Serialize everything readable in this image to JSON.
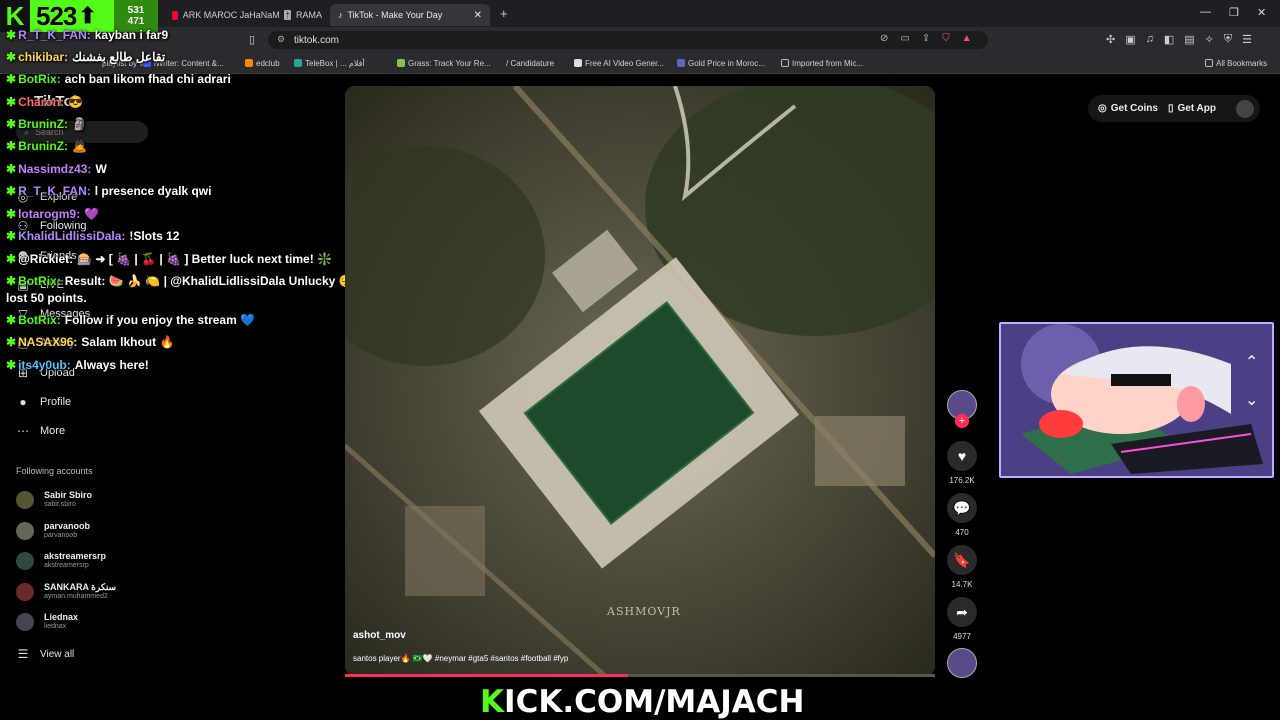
{
  "kick_badge": {
    "viewers": "523",
    "side_top": "531",
    "side_bottom": "471"
  },
  "browser": {
    "tabs": [
      {
        "label": "ARK MAROC JaHaNaM 🎚️ RAMA"
      },
      {
        "label": "TikTok - Make Your Day",
        "active": true
      }
    ],
    "url": "tiktok.com",
    "bookmarks": [
      "playlist by v...",
      "iWriter: Content &...",
      "edclub",
      "TeleBox | ... أفلام",
      "Grass: Track Your Re...",
      "/ Candidature",
      "Free AI Video Gener...",
      "Gold Price in Moroc...",
      "Imported from Mic...",
      "All Bookmarks"
    ]
  },
  "tiktok": {
    "logo": "TikTok",
    "search_placeholder": "Search",
    "nav": [
      "Explore",
      "Following",
      "Friends",
      "LIVE",
      "Messages",
      "Activity",
      "Upload",
      "Profile",
      "More"
    ],
    "following_header": "Following accounts",
    "accounts": [
      {
        "name": "Sabir Sbiro",
        "handle": "sabir.sbiro"
      },
      {
        "name": "parvanoob",
        "handle": "parvanoob"
      },
      {
        "name": "akstreamersrp",
        "handle": "akstreamersrp"
      },
      {
        "name": "SANKARA سنكرة",
        "handle": "ayman.muhammed2"
      },
      {
        "name": "Liednax",
        "handle": "liednax"
      }
    ],
    "view_all": "View all",
    "get_coins": "Get Coins",
    "get_app": "Get App",
    "video": {
      "author": "ashot_mov",
      "caption": "santos player🔥 🇧🇷🤍 #neymar #gta5 #santos #football #fyp",
      "watermark": "ASHMOVJR",
      "progress": 0.48
    },
    "stats": {
      "likes": "176.2K",
      "comments": "470",
      "saves": "14.7K",
      "shares": "4977"
    }
  },
  "chat": [
    {
      "user": "R_T_K_FAN:",
      "text": "kayban i far9",
      "color": "#b388ff"
    },
    {
      "user": "chikibar:",
      "text": "تقاعل طالع بفشنك",
      "color": "#ffd54f"
    },
    {
      "user": "BotRix:",
      "text": "ach ban likom fhad chi adrari",
      "color": "#53fc18"
    },
    {
      "user": "Charon:",
      "text": "😎",
      "color": "#ff6b6b"
    },
    {
      "user": "BruninZ:",
      "text": "🗿",
      "color": "#53fc18"
    },
    {
      "user": "BruninZ:",
      "text": "🙇",
      "color": "#53fc18"
    },
    {
      "user": "Nassimdz43:",
      "text": "W",
      "color": "#c77dff"
    },
    {
      "user": "R_T_K_FAN:",
      "text": "l presence dyalk qwi",
      "color": "#b388ff"
    },
    {
      "user": "lotarogm9:",
      "text": "💜",
      "color": "#c77dff"
    },
    {
      "user": "KhalidLidlissiDala:",
      "text": "!Slots 12",
      "color": "#b388ff"
    },
    {
      "user": "@Rickiet:",
      "text": "🎰 ➜ [ 🍇 | 🍒 | 🍇 ] Better luck next time! ❇️",
      "color": "#ffffff"
    },
    {
      "user": "BotRix:",
      "text": "Result: 🍉 🍌 🍋 | @KhalidLidlissiDala Unlucky 😔 Try again! You",
      "color": "#53fc18"
    },
    {
      "user": "",
      "text": "lost 50 points.",
      "color": "#ffffff"
    },
    {
      "user": "BotRix:",
      "text": "Follow if you enjoy the stream 💙",
      "color": "#53fc18"
    },
    {
      "user": "NASAX96:",
      "text": "Salam lkhout 🔥",
      "color": "#ffd54f"
    },
    {
      "user": "its4y0ub:",
      "text": "Always here!",
      "color": "#4fc3f7"
    }
  ],
  "kick_banner": {
    "k": "K",
    "rest": "ICK.COM/MAJACH"
  },
  "colors": {
    "kick_green": "#53fc18",
    "tiktok_red": "#ff2c55"
  }
}
